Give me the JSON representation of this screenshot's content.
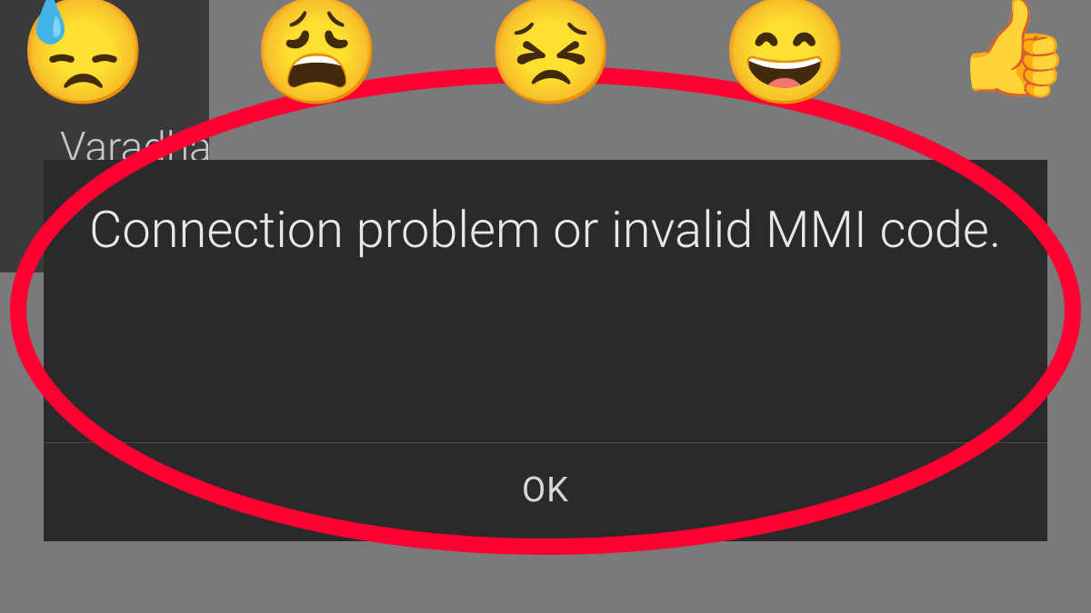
{
  "background": {
    "contact_name": "Varadha"
  },
  "dialog": {
    "message": "Connection problem or invalid MMI code.",
    "button_label": "OK"
  },
  "emojis": {
    "e1": "😓",
    "e2": "😩",
    "e3": "😣",
    "e4": "😄",
    "e5": "👍"
  }
}
